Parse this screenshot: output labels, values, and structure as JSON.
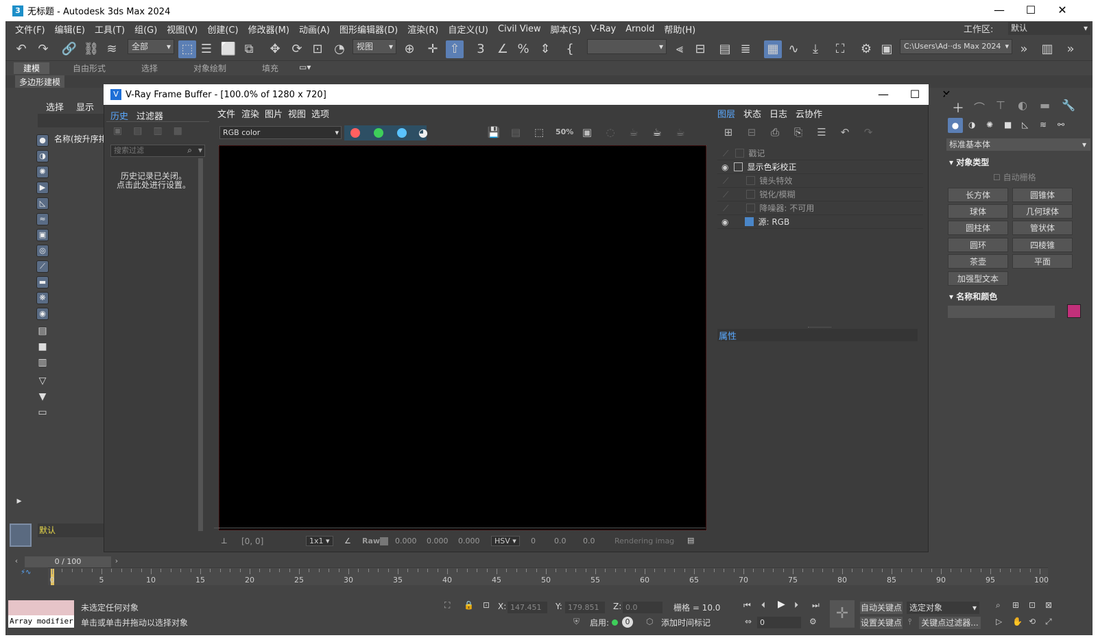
{
  "app": {
    "title": "无标题 - Autodesk 3ds Max 2024",
    "icon": "3"
  },
  "menu": [
    "文件(F)",
    "编辑(E)",
    "工具(T)",
    "组(G)",
    "视图(V)",
    "创建(C)",
    "修改器(M)",
    "动画(A)",
    "图形编辑器(D)",
    "渲染(R)",
    "自定义(U)",
    "Civil View",
    "脚本(S)",
    "V-Ray",
    "Arnold",
    "帮助(H)"
  ],
  "workspace": {
    "label": "工作区:",
    "value": "默认"
  },
  "toolbar": {
    "selection_filter": "全部",
    "ref_coord": "视图",
    "path": "C:\\Users\\Ad··ds Max 2024"
  },
  "ribbon": [
    "建模",
    "自由形式",
    "选择",
    "对象绘制",
    "填充"
  ],
  "ribbon_sub": "多边形建模",
  "scene_explorer": {
    "tabs": [
      "选择",
      "显示"
    ],
    "column": "名称(按升序排",
    "layer": "默认"
  },
  "vfb": {
    "title": "V-Ray Frame Buffer - [100.0% of 1280 x 720]",
    "history_tabs": [
      "历史",
      "过滤器"
    ],
    "search_placeholder": "搜索过滤",
    "history_msg": "历史记录已关闭。\n点击此处进行设置。",
    "menu": [
      "文件",
      "渲染",
      "图片",
      "视图",
      "选项"
    ],
    "channel": "RGB color",
    "layer_tabs": [
      "图层",
      "状态",
      "日志",
      "云协作"
    ],
    "layers": [
      "戳记",
      "显示色彩校正",
      "镜头特效",
      "锐化/模糊",
      "降噪器: 不可用",
      "源: RGB"
    ],
    "props_label": "属性",
    "status": {
      "coords": "[0, 0]",
      "zoom": "1x1",
      "raw": "Raw",
      "v1": "0.000",
      "v2": "0.000",
      "v3": "0.000",
      "mode": "HSV",
      "h": "0",
      "s": "0.0",
      "v": "0.0",
      "rendering": "Rendering image"
    }
  },
  "command_panel": {
    "category": "标准基本体",
    "object_type": "对象类型",
    "auto_grid": "自动栅格",
    "buttons": [
      "长方体",
      "圆锥体",
      "球体",
      "几何球体",
      "圆柱体",
      "管状体",
      "圆环",
      "四棱锥",
      "茶壶",
      "平面",
      "加强型文本"
    ],
    "name_color": "名称和颜色",
    "swatch_color": "#c2307a"
  },
  "timeline": {
    "frame": "0 / 100",
    "ticks": [
      "0",
      "5",
      "10",
      "15",
      "20",
      "25",
      "30",
      "35",
      "40",
      "45",
      "50",
      "55",
      "60",
      "65",
      "70",
      "75",
      "80",
      "85",
      "90",
      "95",
      "100"
    ]
  },
  "status": {
    "script_text": "Array modifier",
    "line1": "未选定任何对象",
    "line2": "单击或单击并拖动以选择对象",
    "x_label": "X:",
    "x": "147.451",
    "y_label": "Y:",
    "y": "179.851",
    "z_label": "Z:",
    "z": "0.0",
    "grid": "栅格 = 10.0",
    "enable": "启用:",
    "add_time_tag": "添加时间标记",
    "auto_key": "自动关键点",
    "set_key": "设置关键点",
    "selected": "选定对象",
    "key_filters": "关键点过滤器...",
    "frame_field": "0"
  }
}
